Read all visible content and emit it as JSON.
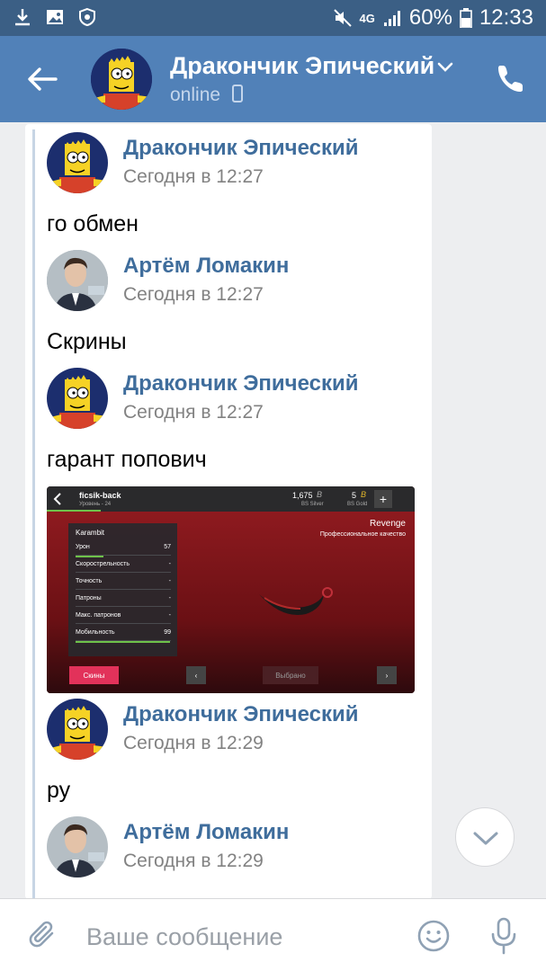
{
  "status_bar": {
    "network": "4G",
    "battery": "60%",
    "time": "12:33",
    "icons": [
      "download-icon",
      "image-icon",
      "shield-icon",
      "mute-icon",
      "signal-icon",
      "battery-icon"
    ]
  },
  "header": {
    "contact_name": "Дракончик Эпический",
    "status": "online"
  },
  "messages": [
    {
      "author": "Дракончик Эпический",
      "time": "Сегодня в 12:27",
      "text": "го обмен"
    },
    {
      "author": "Артём Ломакин",
      "time": "Сегодня в 12:27",
      "text": "Скрины"
    },
    {
      "author": "Дракончик Эпический",
      "time": "Сегодня в 12:27",
      "text": "гарант попович"
    },
    {
      "author": "Дракончик Эпический",
      "time": "Сегодня в 12:29",
      "text": "ру"
    },
    {
      "author": "Артём Ломакин",
      "time": "Сегодня в 12:29",
      "text": ""
    }
  ],
  "screenshot": {
    "player": "ficsik-back",
    "level": "Уровень - 24",
    "silver_amount": "1,675",
    "silver_label": "BS Silver",
    "gold_amount": "5",
    "gold_label": "BS Gold",
    "skin_name": "Revenge",
    "quality": "Профессиональное качество",
    "weapon": "Karambit",
    "stats": [
      {
        "label": "Урон",
        "value": "57",
        "fill": 0.57
      },
      {
        "label": "Скорострельность",
        "value": "-"
      },
      {
        "label": "Точность",
        "value": "-"
      },
      {
        "label": "Патроны",
        "value": "-"
      },
      {
        "label": "Макс. патронов",
        "value": "-"
      },
      {
        "label": "Мобильность",
        "value": "99",
        "fill": 0.99
      }
    ],
    "skins_button": "Скины",
    "selected_button": "Выбрано"
  },
  "composer": {
    "placeholder": "Ваше сообщение"
  },
  "colors": {
    "status_bar": "#3b5f85",
    "header": "#5181b8",
    "author_link": "#3f6d9c",
    "background": "#edeef0"
  }
}
